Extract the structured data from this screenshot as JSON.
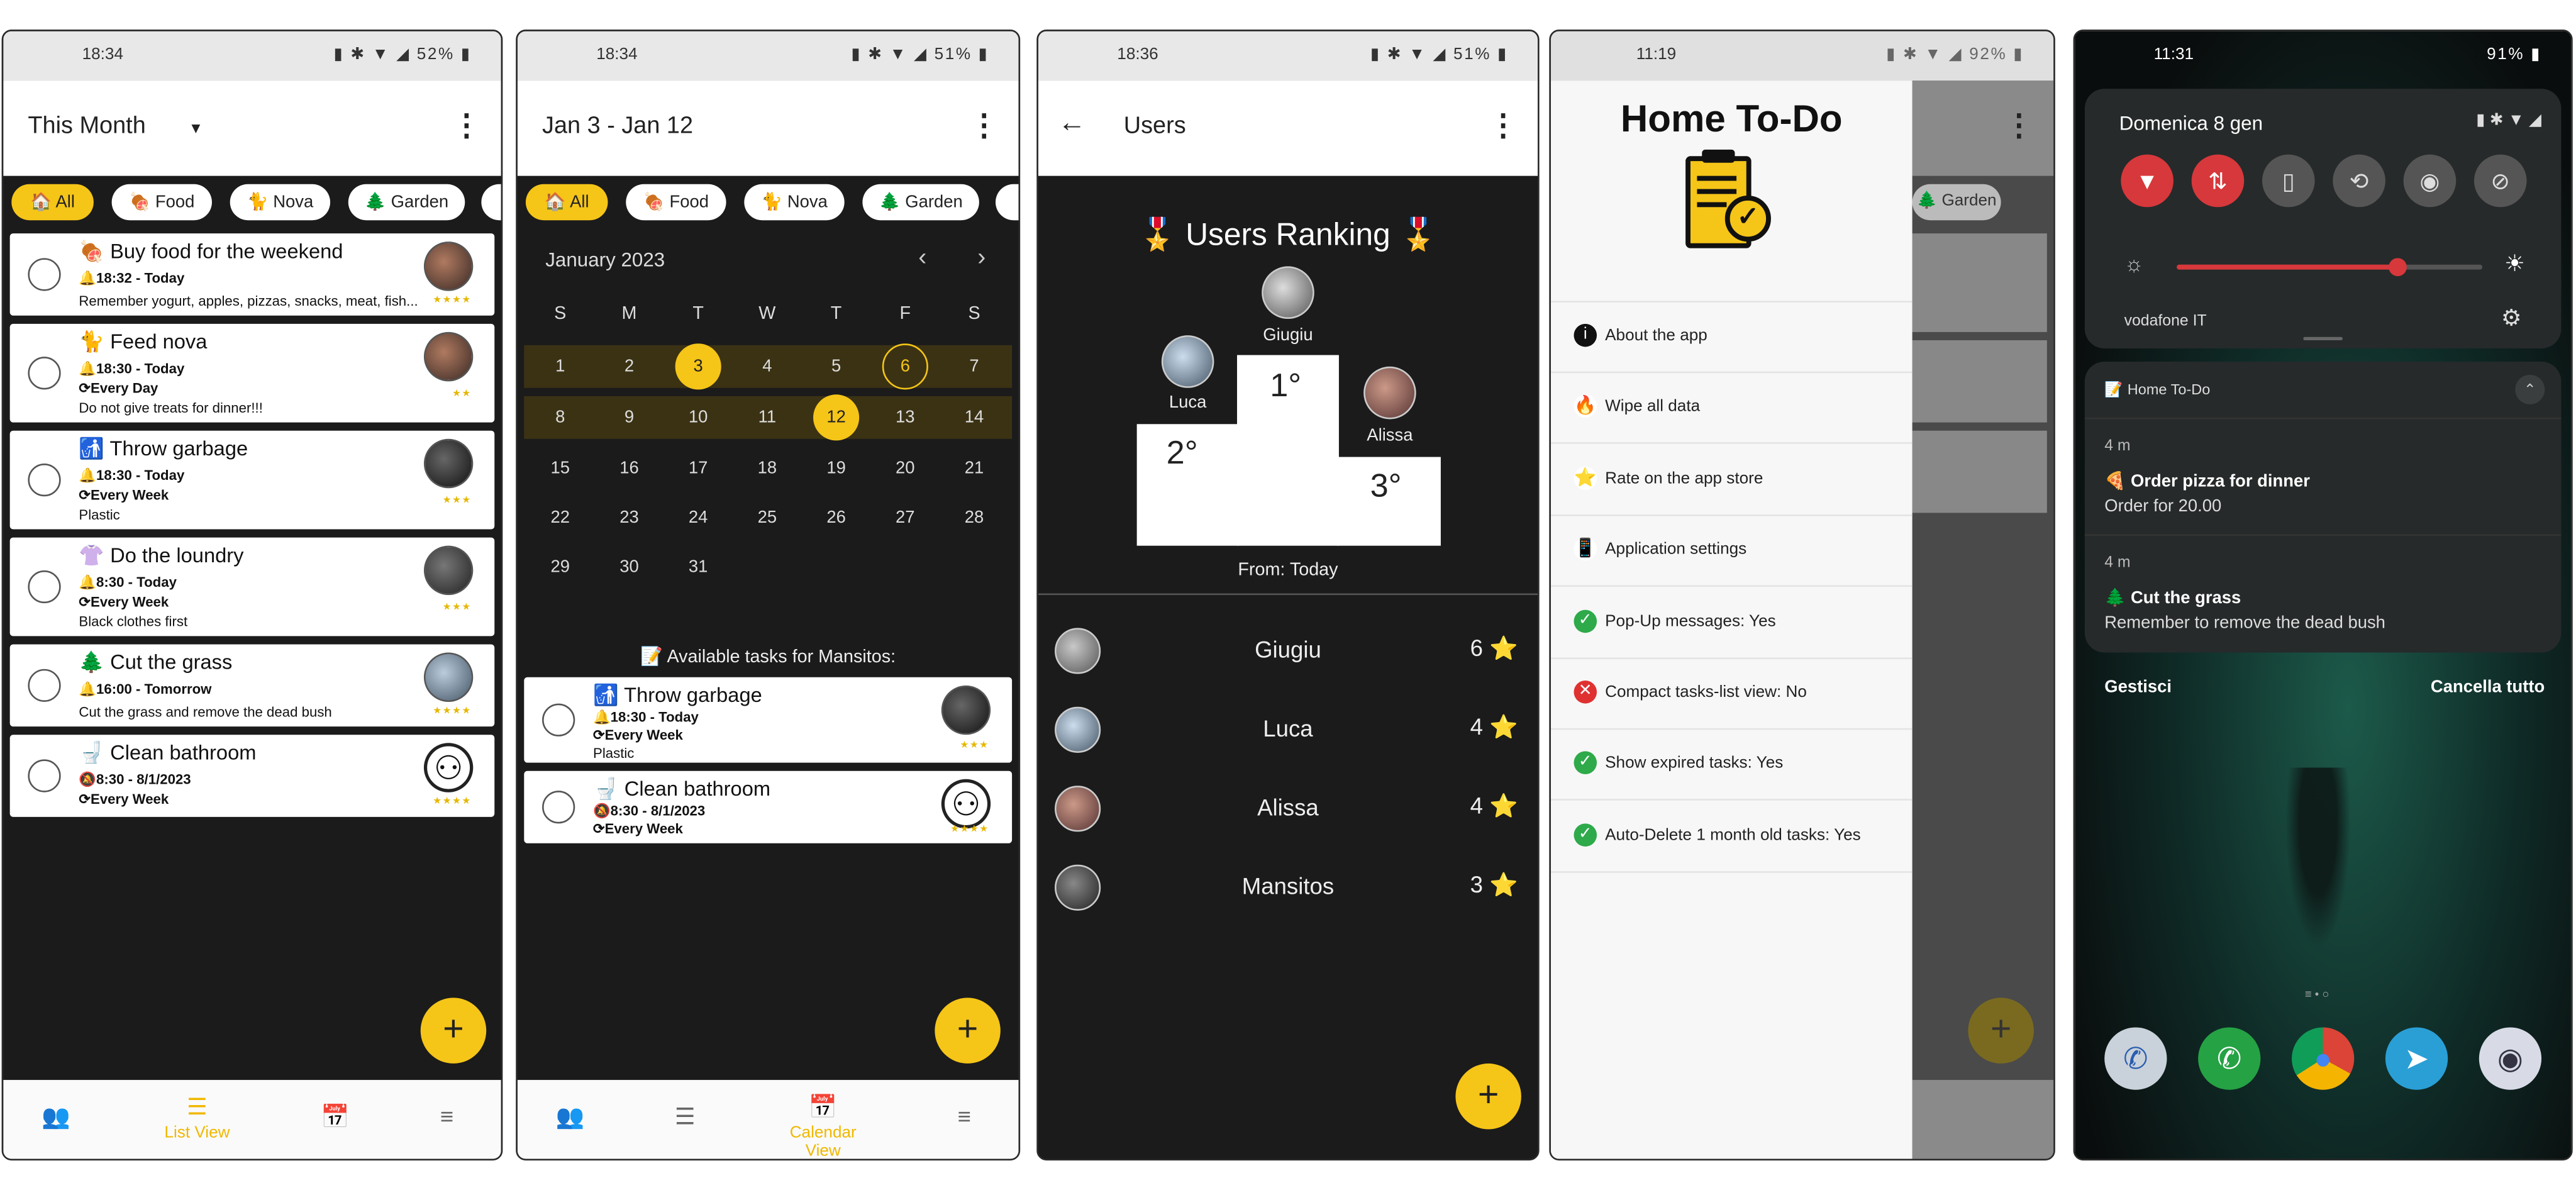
{
  "screen1": {
    "status": {
      "time": "18:34",
      "battery": "52%"
    },
    "title": "This Month",
    "menu_icon": "more-vert-icon",
    "chips": [
      {
        "label": "🏠 All",
        "selected": true
      },
      {
        "label": "🍖 Food",
        "selected": false
      },
      {
        "label": "🐈 Nova",
        "selected": false
      },
      {
        "label": "🌲 Garden",
        "selected": false
      }
    ],
    "tasks": [
      {
        "title": "🍖 Buy food for the weekend",
        "time": "🔔18:32 - Today",
        "repeat": "",
        "note": "Remember yogurt, apples, pizzas, snacks, meat, fish...",
        "stars": "★★★★"
      },
      {
        "title": "🐈 Feed nova",
        "time": "🔔18:30 - Today",
        "repeat": "⟳Every Day",
        "note": "Do not give treats for dinner!!!",
        "stars": "★★"
      },
      {
        "title": "🚮 Throw garbage",
        "time": "🔔18:30 - Today",
        "repeat": "⟳Every Week",
        "note": "Plastic",
        "stars": "★★★"
      },
      {
        "title": "👚 Do the loundry",
        "time": "🔔8:30 - Today",
        "repeat": "⟳Every Week",
        "note": "Black clothes first",
        "stars": "★★★"
      },
      {
        "title": "🌲 Cut the grass",
        "time": "🔔16:00 - Tomorrow",
        "repeat": "",
        "note": "Cut the grass and remove the dead bush",
        "stars": "★★★★"
      },
      {
        "title": "🚽 Clean bathroom",
        "time": "🔕8:30 - 8/1/2023",
        "repeat": "⟳Every Week",
        "note": "",
        "stars": "★★★★"
      }
    ],
    "fab": "+",
    "nav": {
      "active_label": "List View"
    }
  },
  "screen2": {
    "status": {
      "time": "18:34",
      "battery": "51%"
    },
    "title": "Jan 3 - Jan 12",
    "chips": [
      {
        "label": "🏠 All",
        "selected": true
      },
      {
        "label": "🍖 Food",
        "selected": false
      },
      {
        "label": "🐈 Nova",
        "selected": false
      },
      {
        "label": "🌲 Garden",
        "selected": false
      }
    ],
    "month": "January 2023",
    "weekdays": [
      "S",
      "M",
      "T",
      "W",
      "T",
      "F",
      "S"
    ],
    "weeks": [
      [
        "1",
        "2",
        "3",
        "4",
        "5",
        "6",
        "7"
      ],
      [
        "8",
        "9",
        "10",
        "11",
        "12",
        "13",
        "14"
      ],
      [
        "15",
        "16",
        "17",
        "18",
        "19",
        "20",
        "21"
      ],
      [
        "22",
        "23",
        "24",
        "25",
        "26",
        "27",
        "28"
      ],
      [
        "29",
        "30",
        "31",
        "",
        "",
        "",
        ""
      ]
    ],
    "available_title": "📝 Available tasks for Mansitos:",
    "tasks": [
      {
        "title": "🚮 Throw garbage",
        "time": "🔔18:30 - Today",
        "repeat": "⟳Every Week",
        "note": "Plastic",
        "stars": "★★★"
      },
      {
        "title": "🚽 Clean bathroom",
        "time": "🔕8:30 - 8/1/2023",
        "repeat": "⟳Every Week",
        "note": "",
        "stars": "★★★★"
      }
    ],
    "fab": "+",
    "nav": {
      "active_label": "Calendar View"
    }
  },
  "screen3": {
    "status": {
      "time": "18:36",
      "battery": "51%"
    },
    "title": "Users",
    "ranking_title": "🎖️ Users Ranking 🎖️",
    "podium": {
      "first": {
        "name": "Giugiu",
        "place": "1°"
      },
      "second": {
        "name": "Luca",
        "place": "2°"
      },
      "third": {
        "name": "Alissa",
        "place": "3°"
      }
    },
    "from_label": "From: Today",
    "users": [
      {
        "name": "Giugiu",
        "score": "6 ⭐"
      },
      {
        "name": "Luca",
        "score": "4 ⭐"
      },
      {
        "name": "Alissa",
        "score": "4 ⭐"
      },
      {
        "name": "Mansitos",
        "score": "3 ⭐"
      }
    ],
    "fab": "+"
  },
  "screen4": {
    "status": {
      "time": "11:19",
      "battery": "92%"
    },
    "drawer_title": "Home To-Do",
    "items": [
      {
        "label": "About the app",
        "icon": "info-icon",
        "color": "#111111",
        "glyph": "i"
      },
      {
        "label": "Wipe all data",
        "icon": "fire-icon",
        "color": "#ffffff",
        "glyph": "🔥"
      },
      {
        "label": "Rate on the app store",
        "icon": "star-icon",
        "color": "#ffffff",
        "glyph": "⭐"
      },
      {
        "label": "Application settings",
        "icon": "phone-settings-icon",
        "color": "#ffffff",
        "glyph": "📱"
      },
      {
        "label": "Pop-Up messages: Yes",
        "icon": "check-icon",
        "color": "#2eaa4a",
        "glyph": "✓"
      },
      {
        "label": "Compact tasks-list view: No",
        "icon": "cross-icon",
        "color": "#e03131",
        "glyph": "✕"
      },
      {
        "label": "Show expired tasks: Yes",
        "icon": "check-icon",
        "color": "#2eaa4a",
        "glyph": "✓"
      },
      {
        "label": "Auto-Delete 1 month old tasks: Yes",
        "icon": "check-icon",
        "color": "#2eaa4a",
        "glyph": "✓"
      }
    ],
    "behind_chip": "🌲 Garden",
    "fab": "+"
  },
  "screen5": {
    "status": {
      "time": "11:31",
      "battery": "91%"
    },
    "date": "Domenica 8 gen",
    "carrier": "vodafone IT",
    "brightness": 0.72,
    "app_name": "Home To-Do",
    "notifications": [
      {
        "age": "4 m",
        "title": "🍕 Order pizza for dinner",
        "body": "Order for 20.00"
      },
      {
        "age": "4 m",
        "title": "🌲 Cut the grass",
        "body": "Remember to remove the dead bush"
      }
    ],
    "manage_label": "Gestisci",
    "clear_label": "Cancella tutto"
  },
  "colors": {
    "accent": "#f5c518",
    "dark_bg": "#1b1b1b"
  }
}
